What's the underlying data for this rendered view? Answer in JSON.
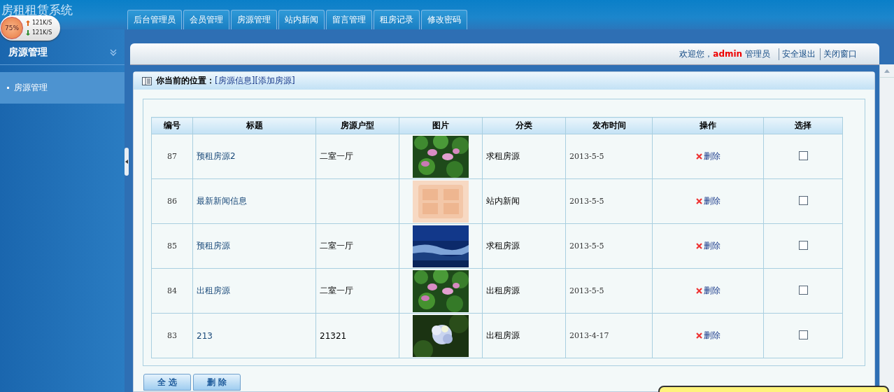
{
  "app_title": "房租租赁系统",
  "speed_widget": {
    "percent": "75%",
    "up": "121K/S",
    "down": "121K/S"
  },
  "nav_tabs": [
    {
      "label": "后台管理员",
      "selected": false
    },
    {
      "label": "会员管理",
      "selected": false
    },
    {
      "label": "房源管理",
      "selected": false
    },
    {
      "label": "站内新闻",
      "selected": false
    },
    {
      "label": "留言管理",
      "selected": false
    },
    {
      "label": "租房记录",
      "selected": false
    },
    {
      "label": "修改密码",
      "selected": false
    }
  ],
  "sidebar": {
    "title": "房源管理",
    "items": [
      {
        "label": "房源管理",
        "selected": true
      }
    ]
  },
  "top_bar": {
    "welcome": "欢迎您，**admin** 管理员",
    "links": [
      "安全退出",
      "关闭窗口"
    ]
  },
  "breadcrumb": {
    "label": "你当前的位置：",
    "links": [
      "[房源信息]",
      "[添加房源]"
    ]
  },
  "table": {
    "columns": [
      "编号",
      "标题",
      "房源户型",
      "图片",
      "分类",
      "发布时间",
      "操作",
      "选择"
    ],
    "rows": [
      {
        "id": "87",
        "title": "预租房源2",
        "layout": "二室一厅",
        "category": "求租房源",
        "date": "2013-5-5",
        "action": "删除",
        "checked": false
      },
      {
        "id": "86",
        "title": "最新新闻信息",
        "layout": "",
        "category": "站内新闻",
        "date": "2013-5-5",
        "action": "删除",
        "checked": false
      },
      {
        "id": "85",
        "title": "预租房源",
        "layout": "二室一厅",
        "category": "求租房源",
        "date": "2013-5-5",
        "action": "删除",
        "checked": false
      },
      {
        "id": "84",
        "title": "出租房源",
        "layout": "二室一厅",
        "category": "出租房源",
        "date": "2013-5-5",
        "action": "删除",
        "checked": false
      },
      {
        "id": "83",
        "title": "213",
        "layout": "21321",
        "category": "出租房源",
        "date": "2013-4-17",
        "action": "删除",
        "checked": false
      }
    ]
  },
  "buttons": [
    "全 选",
    "删 除"
  ]
}
